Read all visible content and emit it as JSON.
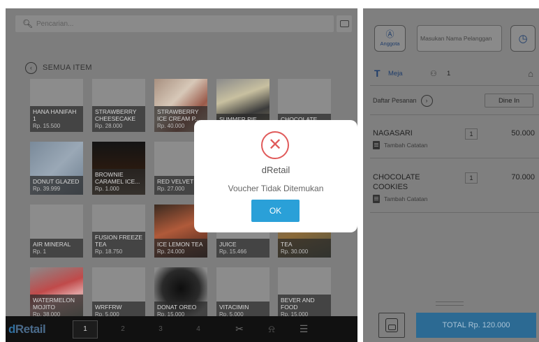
{
  "search": {
    "placeholder": "Pencarian..."
  },
  "category": {
    "label": "SEMUA ITEM"
  },
  "items": [
    {
      "name": "HANA HANIFAH 1",
      "price": "Rp. 15.500",
      "img": ""
    },
    {
      "name": "STRAWBERRY CHEESECAKE",
      "price": "Rp. 28.000",
      "img": ""
    },
    {
      "name": "STRAWBERRY ICE CREAM P...",
      "price": "Rp. 40.000",
      "img": "dessert"
    },
    {
      "name": "SUMMER PIE CREAM",
      "price": "",
      "img": "pie"
    },
    {
      "name": "CHOCOLATE COOKIES",
      "price": "",
      "img": ""
    },
    {
      "name": "DONUT GLAZED",
      "price": "Rp. 39.999",
      "img": "donut"
    },
    {
      "name": "BROWNIE CARAMEL ICE...",
      "price": "Rp. 1.000",
      "img": "brownie"
    },
    {
      "name": "RED VELVET",
      "price": "Rp. 27.000",
      "img": ""
    },
    {
      "name": "",
      "price": "",
      "img": ""
    },
    {
      "name": "",
      "price": "",
      "img": ""
    },
    {
      "name": "AIR MINERAL",
      "price": "Rp. 1",
      "img": ""
    },
    {
      "name": "FUSION FREEZE TEA",
      "price": "Rp. 18.750",
      "img": ""
    },
    {
      "name": "ICE LEMON TEA",
      "price": "Rp. 24.000",
      "img": "lemontea"
    },
    {
      "name": "JUICE",
      "price": "Rp. 15.466",
      "img": ""
    },
    {
      "name": "TEA",
      "price": "Rp. 30.000",
      "img": "tea"
    },
    {
      "name": "WATERMELON MOJITO",
      "price": "Rp. 38.000",
      "img": "watermelon"
    },
    {
      "name": "WRFFRW",
      "price": "Rp. 5.000",
      "img": ""
    },
    {
      "name": "DONAT OREO",
      "price": "Rp. 15.000",
      "img": "oreo"
    },
    {
      "name": "VITACIMIN",
      "price": "Rp. 5.000",
      "img": ""
    },
    {
      "name": "BEVER AND FOOD",
      "price": "Rp. 15.000",
      "img": ""
    }
  ],
  "bottombar": {
    "brand_prefix": "d",
    "brand_suffix": "Retail",
    "pages": [
      "1",
      "2",
      "3",
      "4"
    ],
    "active_page": "1",
    "icons": [
      "voucher-icon",
      "bell-icon",
      "menu-list-icon"
    ]
  },
  "customer": {
    "member_label": "Anggota",
    "name_placeholder": "Masukan Nama Pelanggan"
  },
  "table": {
    "label": "Meja",
    "guests": "1"
  },
  "order_list": {
    "label": "Daftar Pesanan",
    "dine_label": "Dine In",
    "note_label": "Tambah Catatan",
    "orders": [
      {
        "name": "NAGASARI",
        "qty": "1",
        "amount": "50.000"
      },
      {
        "name": "CHOCOLATE COOKIES",
        "qty": "1",
        "amount": "70.000"
      }
    ]
  },
  "total": {
    "label": "TOTAL Rp. 120.000"
  },
  "modal": {
    "title": "dRetail",
    "message": "Voucher Tidak Ditemukan",
    "ok_label": "OK"
  },
  "colors": {
    "accent": "#2aa0d8",
    "error": "#e05a5a",
    "total_button": "#2c6a93"
  }
}
